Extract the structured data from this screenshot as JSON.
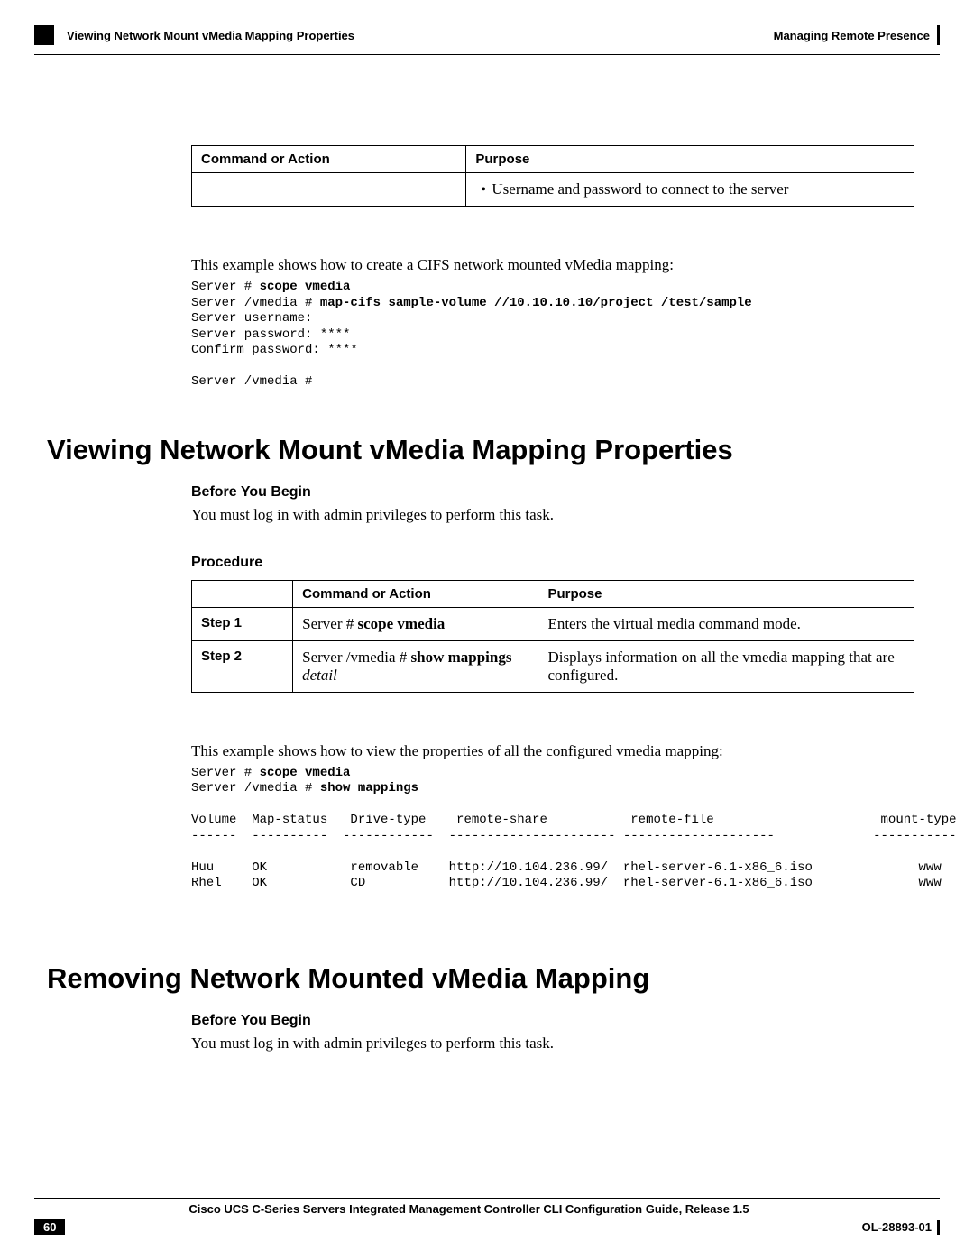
{
  "header": {
    "left_title": "Viewing Network Mount vMedia Mapping Properties",
    "right_title": "Managing Remote Presence"
  },
  "table1": {
    "headers": {
      "command": "Command or Action",
      "purpose": "Purpose"
    },
    "row_purpose_bullet": "Username and password to connect to the server"
  },
  "cifs": {
    "intro": "This example shows how to create a CIFS network mounted vMedia mapping:",
    "line1_prefix": "Server # ",
    "line1_cmd": "scope vmedia",
    "line2_prefix": "Server /vmedia # ",
    "line2_cmd": "map-cifs sample-volume //10.10.10.10/project /test/sample",
    "line3": "Server username:",
    "line4": "Server password: ****",
    "line5": "Confirm password: ****",
    "line6": "Server /vmedia #"
  },
  "sec2": {
    "heading": "Viewing Network Mount vMedia Mapping Properties",
    "before_title": "Before You Begin",
    "before_text": "You must log in with admin privileges to perform this task.",
    "procedure_title": "Procedure",
    "table": {
      "headers": {
        "step_blank": "",
        "command": "Command or Action",
        "purpose": "Purpose"
      },
      "step1": {
        "label": "Step 1",
        "cmd_prefix": "Server # ",
        "cmd_bold": "scope vmedia",
        "purpose": "Enters the virtual media command mode."
      },
      "step2": {
        "label": "Step 2",
        "cmd_prefix": "Server /vmedia # ",
        "cmd_bold": "show mappings",
        "cmd_italic": " detail",
        "purpose": "Displays information on all the vmedia mapping that are configured."
      }
    },
    "example_intro": "This example shows how to view the properties of all the configured vmedia mapping:",
    "example_line1_prefix": "Server # ",
    "example_line1_cmd": "scope vmedia",
    "example_line2_prefix": "Server /vmedia # ",
    "example_line2_cmd": "show mappings",
    "table_output": "Volume  Map-status   Drive-type    remote-share           remote-file                      mount-type\n------  ----------  ------------  ---------------------- --------------------             -----------\n\nHuu     OK           removable    http://10.104.236.99/  rhel-server-6.1-x86_6.iso              www\nRhel    OK           CD           http://10.104.236.99/  rhel-server-6.1-x86_6.iso              www"
  },
  "sec3": {
    "heading": "Removing Network Mounted vMedia Mapping",
    "before_title": "Before You Begin",
    "before_text": "You must log in with admin privileges to perform this task."
  },
  "footer": {
    "book_title": "Cisco UCS C-Series Servers Integrated Management Controller CLI Configuration Guide, Release 1.5",
    "page_number": "60",
    "doc_id": "OL-28893-01"
  }
}
